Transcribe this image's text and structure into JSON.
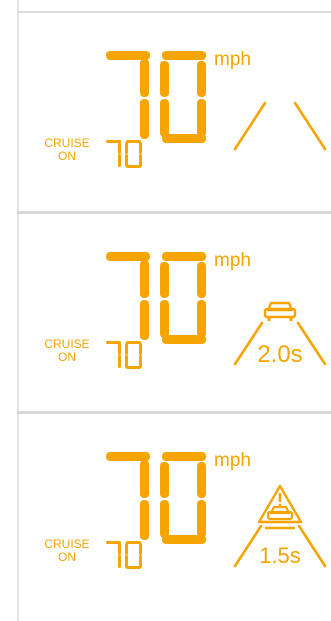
{
  "colors": {
    "accent": "#f5a400",
    "background": "#ffffff",
    "divider": "#d7d7d7"
  },
  "panels": [
    {
      "speed": "70",
      "unit": "mph",
      "cruise": {
        "line1": "CRUISE",
        "line2": "ON",
        "set_speed": "70"
      },
      "lead_vehicle": false,
      "gap": "",
      "warning": false
    },
    {
      "speed": "70",
      "unit": "mph",
      "cruise": {
        "line1": "CRUISE",
        "line2": "ON",
        "set_speed": "70"
      },
      "lead_vehicle": true,
      "gap": "2.0s",
      "warning": false
    },
    {
      "speed": "70",
      "unit": "mph",
      "cruise": {
        "line1": "CRUISE",
        "line2": "ON",
        "set_speed": "70"
      },
      "lead_vehicle": true,
      "gap": "1.5s",
      "warning": true
    }
  ]
}
